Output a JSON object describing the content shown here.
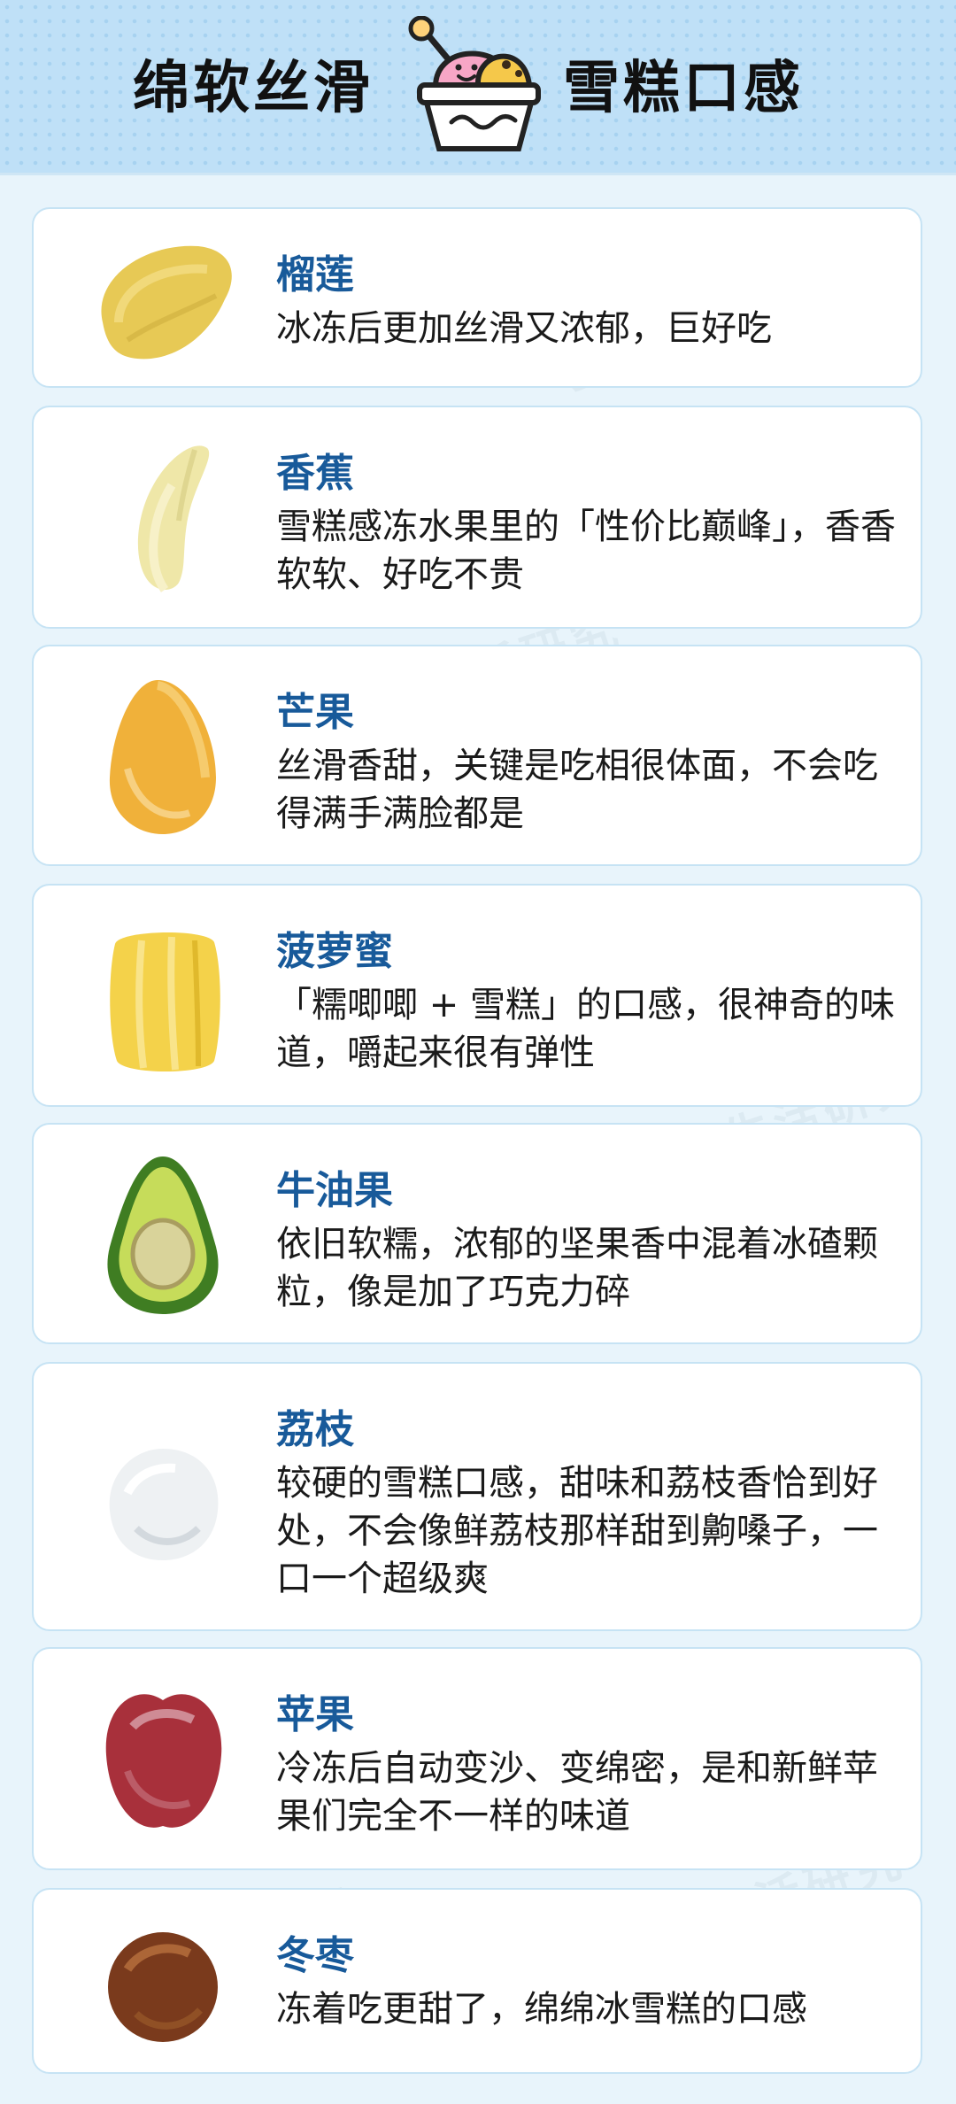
{
  "header": {
    "title_left": "绵软丝滑",
    "title_right": "雪糕口感"
  },
  "watermark": "丁香生活研究",
  "items": [
    {
      "name": "榴莲",
      "desc": "冰冻后更加丝滑又浓郁，巨好吃",
      "icon": "durian-icon"
    },
    {
      "name": "香蕉",
      "desc": "雪糕感冻水果里的「性价比巅峰」，香香软软、好吃不贵",
      "icon": "banana-icon"
    },
    {
      "name": "芒果",
      "desc": "丝滑香甜，关键是吃相很体面，不会吃得满手满脸都是",
      "icon": "mango-icon"
    },
    {
      "name": "菠萝蜜",
      "desc": "「糯唧唧 + 雪糕」的口感，很神奇的味道，嚼起来很有弹性",
      "icon": "jackfruit-icon"
    },
    {
      "name": "牛油果",
      "desc": "依旧软糯，浓郁的坚果香中混着冰碴颗粒，像是加了巧克力碎",
      "icon": "avocado-icon"
    },
    {
      "name": "荔枝",
      "desc": "较硬的雪糕口感，甜味和荔枝香恰到好处，不会像鲜荔枝那样甜到齁嗓子，一口一个超级爽",
      "icon": "lychee-icon"
    },
    {
      "name": "苹果",
      "desc": "冷冻后自动变沙、变绵密，是和新鲜苹果们完全不一样的味道",
      "icon": "apple-icon"
    },
    {
      "name": "冬枣",
      "desc": "冻着吃更甜了，绵绵冰雪糕的口感",
      "icon": "winter-jujube-icon"
    }
  ]
}
